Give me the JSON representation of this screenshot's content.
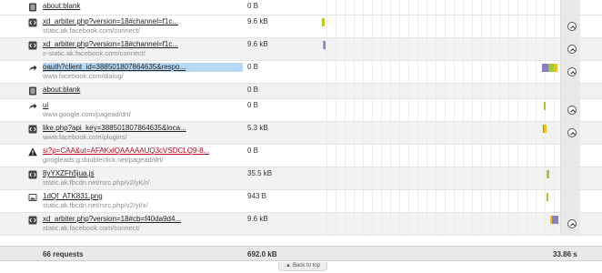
{
  "rows": [
    {
      "icon": "document-icon",
      "title": "about:blank",
      "domain": "",
      "size": "0 B",
      "alt": false,
      "height": "h1",
      "expand": false,
      "bars": []
    },
    {
      "icon": "script-icon",
      "title": "xd_arbiter.php?version=18#channel=f1c...",
      "domain": "static.ak.facebook.com/connect/",
      "size": "9.6 kB",
      "alt": false,
      "height": "h2",
      "expand": true,
      "bars": [
        {
          "start": 4,
          "segs": [
            [
              "#9ccc3c",
              2
            ],
            [
              "#f1c40f",
              1
            ]
          ]
        }
      ]
    },
    {
      "icon": "script-icon",
      "title": "xd_arbiter.php?version=18#channel=f1c...",
      "domain": "s-static.ak.facebook.com/connect/",
      "size": "9.6 kB",
      "alt": true,
      "height": "h2",
      "expand": true,
      "bars": [
        {
          "start": 5,
          "segs": [
            [
              "#9ccc3c",
              1
            ],
            [
              "#8e7cc3",
              2
            ]
          ]
        }
      ]
    },
    {
      "icon": "redirect-icon",
      "title": "oauth?client_id=388501807864635&respo...",
      "domain": "www.facebook.com/dialog/",
      "size": "0 B",
      "alt": false,
      "height": "h2",
      "expand": true,
      "selected": true,
      "bars": [
        {
          "start": 246,
          "segs": [
            [
              "#8e7cc3",
              7
            ],
            [
              "#9ccc3c",
              6
            ],
            [
              "#f1c40f",
              4
            ]
          ]
        }
      ]
    },
    {
      "icon": "document-icon",
      "title": "about:blank",
      "domain": "",
      "size": "0 B",
      "alt": true,
      "height": "h1",
      "expand": false,
      "bars": []
    },
    {
      "icon": "redirect-icon",
      "title": "ui",
      "domain": "www.google.com/pagead/drt/",
      "size": "0 B",
      "alt": false,
      "height": "h2",
      "expand": true,
      "bars": [
        {
          "start": 248,
          "segs": [
            [
              "#bcbc3c",
              2
            ]
          ]
        }
      ]
    },
    {
      "icon": "script-icon",
      "title": "like.php?api_key=388501807864635&loca...",
      "domain": "www.facebook.com/plugins/",
      "size": "5.3 kB",
      "alt": true,
      "height": "h2",
      "expand": true,
      "bars": [
        {
          "start": 247,
          "segs": [
            [
              "#8e7cc3",
              1
            ],
            [
              "#f1c40f",
              3
            ]
          ]
        }
      ]
    },
    {
      "icon": "warning-icon",
      "title": "si?p=CAA&ut=AFAKxlQAAAAAUQ3cVSDCLQ9-8...",
      "domain": "googleads.g.doubleclick.net/pagead/drt/",
      "size": "0 B",
      "alt": false,
      "height": "h2",
      "expand": false,
      "error": true,
      "bars": []
    },
    {
      "icon": "script-icon",
      "title": "8yYXZFh5jua.js",
      "domain": "static.ak.fbcdn.net/rsrc.php/v2/yK/r/",
      "size": "35.5 kB",
      "alt": true,
      "height": "h2",
      "expand": false,
      "bars": [
        {
          "start": 251,
          "segs": [
            [
              "#bcbc3c",
              3
            ]
          ]
        }
      ]
    },
    {
      "icon": "image-icon",
      "title": "1dQf_ATK831.png",
      "domain": "static.ak.fbcdn.net/rsrc.php/v2/yI/x/",
      "size": "943 B",
      "alt": false,
      "height": "h2",
      "expand": false,
      "bars": [
        {
          "start": 251,
          "segs": [
            [
              "#bcbc3c",
              2
            ]
          ]
        }
      ]
    },
    {
      "icon": "script-icon",
      "title": "xd_arbiter.php?version=18#cb=f40da9d4...",
      "domain": "static.ak.facebook.com/connect/",
      "size": "9.6 kB",
      "alt": true,
      "height": "h2",
      "expand": true,
      "bars": [
        {
          "start": 255,
          "segs": [
            [
              "#f1c40f",
              2
            ],
            [
              "#8e7cc3",
              7
            ]
          ]
        }
      ]
    }
  ],
  "summary": {
    "requests": "66 requests",
    "total_size": "692.0 kB",
    "total_time": "33.86 s"
  },
  "back_to_top": "Back to top"
}
